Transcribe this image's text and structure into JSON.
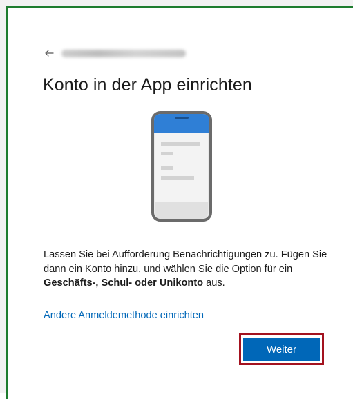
{
  "header": {
    "back_icon": "arrow-left-icon",
    "email": "••••••••••••••••••••"
  },
  "title": "Konto in der App einrichten",
  "illustration": {
    "icon": "phone-app-icon",
    "accent_color": "#2f7fd6"
  },
  "description": {
    "part1": "Lassen Sie bei Aufforderung Benachrichtigungen zu. Fügen Sie dann ein Konto hinzu, und wählen Sie die Option für ein ",
    "bold": "Geschäfts-, Schul- oder Unikonto",
    "part2": " aus."
  },
  "alt_link": "Andere Anmeldemethode einrichten",
  "next_button": "Weiter",
  "colors": {
    "frame_green": "#1e7c2f",
    "highlight_red": "#a3121f",
    "primary_blue": "#0067b8"
  }
}
